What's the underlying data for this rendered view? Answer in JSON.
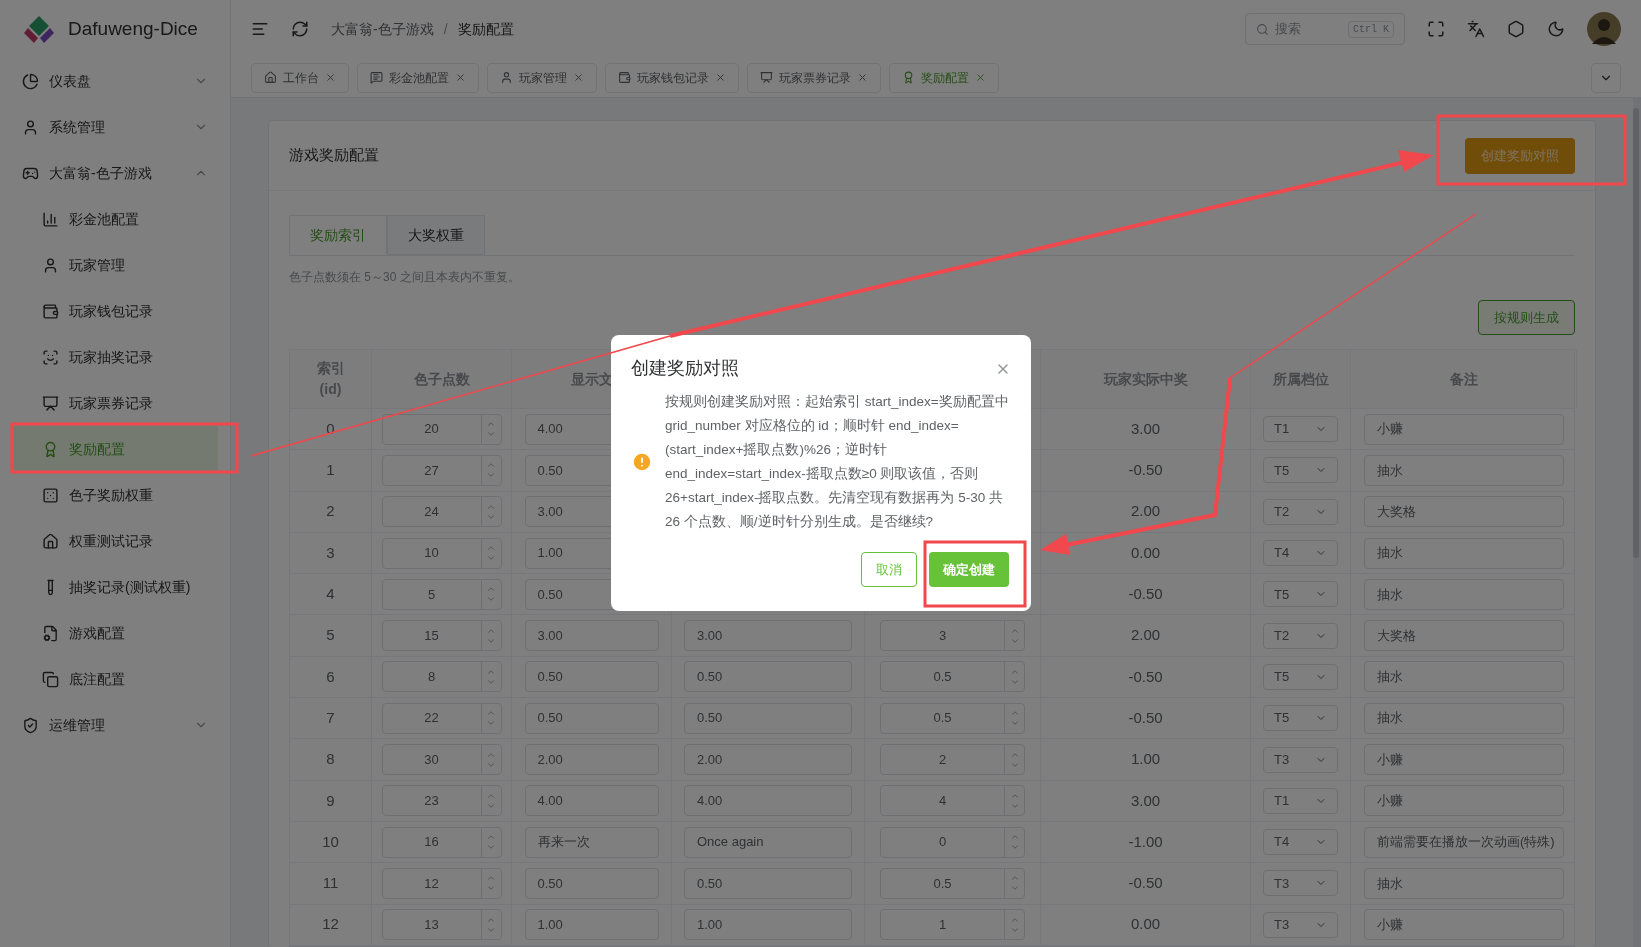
{
  "app": {
    "title": "Dafuweng-Dice"
  },
  "header": {
    "breadcrumb": [
      "大富翁-色子游戏",
      "奖励配置"
    ],
    "separator": "/",
    "search": {
      "placeholder": "搜索",
      "shortcut": "Ctrl K"
    }
  },
  "page_tabs": [
    {
      "label": "工作台",
      "selected": false
    },
    {
      "label": "彩金池配置",
      "selected": false
    },
    {
      "label": "玩家管理",
      "selected": false
    },
    {
      "label": "玩家钱包记录",
      "selected": false
    },
    {
      "label": "玩家票券记录",
      "selected": false
    },
    {
      "label": "奖励配置",
      "selected": true
    }
  ],
  "sidebar": {
    "items": [
      {
        "label": "仪表盘",
        "expanded": false
      },
      {
        "label": "系统管理",
        "expanded": false
      },
      {
        "label": "大富翁-色子游戏",
        "expanded": true,
        "children": [
          {
            "label": "彩金池配置",
            "selected": false
          },
          {
            "label": "玩家管理",
            "selected": false
          },
          {
            "label": "玩家钱包记录",
            "selected": false
          },
          {
            "label": "玩家抽奖记录",
            "selected": false
          },
          {
            "label": "玩家票券记录",
            "selected": false
          },
          {
            "label": "奖励配置",
            "selected": true
          },
          {
            "label": "色子奖励权重",
            "selected": false
          },
          {
            "label": "权重测试记录",
            "selected": false
          },
          {
            "label": "抽奖记录(测试权重)",
            "selected": false
          },
          {
            "label": "游戏配置",
            "selected": false
          },
          {
            "label": "底注配置",
            "selected": false
          }
        ]
      },
      {
        "label": "运维管理",
        "expanded": false
      }
    ]
  },
  "card": {
    "title": "游戏奖励配置",
    "create_button": "创建奖励对照",
    "tabs": [
      {
        "label": "奖励索引",
        "selected": true
      },
      {
        "label": "大奖权重",
        "selected": false
      }
    ],
    "hint": "色子点数须在 5～30 之间且本表内不重复。",
    "generate_button": "按规则生成",
    "table": {
      "columns": [
        {
          "label": "索引 (id)"
        },
        {
          "label": "色子点数"
        },
        {
          "label": "显示文"
        },
        {},
        {},
        {
          "label": "玩家实际中奖"
        },
        {
          "label": "所属档位"
        },
        {
          "label": "备注"
        }
      ],
      "rows": [
        {
          "index": "0",
          "dice": "20",
          "display": "4.00",
          "actual": "3.00",
          "tier": "T1",
          "remark": "小赚"
        },
        {
          "index": "1",
          "dice": "27",
          "display": "0.50",
          "actual": "-0.50",
          "tier": "T5",
          "remark": "抽水"
        },
        {
          "index": "2",
          "dice": "24",
          "display": "3.00",
          "actual": "2.00",
          "tier": "T2",
          "remark": "大奖格"
        },
        {
          "index": "3",
          "dice": "10",
          "display": "1.00",
          "actual": "0.00",
          "tier": "T4",
          "remark": "抽水"
        },
        {
          "index": "4",
          "dice": "5",
          "display": "0.50",
          "actual": "-0.50",
          "tier": "T5",
          "remark": "抽水"
        },
        {
          "index": "5",
          "dice": "15",
          "display": "3.00",
          "display_en": "3.00",
          "multiplier": "3",
          "actual": "2.00",
          "tier": "T2",
          "remark": "大奖格"
        },
        {
          "index": "6",
          "dice": "8",
          "display": "0.50",
          "display_en": "0.50",
          "multiplier": "0.5",
          "actual": "-0.50",
          "tier": "T5",
          "remark": "抽水"
        },
        {
          "index": "7",
          "dice": "22",
          "display": "0.50",
          "display_en": "0.50",
          "multiplier": "0.5",
          "actual": "-0.50",
          "tier": "T5",
          "remark": "抽水"
        },
        {
          "index": "8",
          "dice": "30",
          "display": "2.00",
          "display_en": "2.00",
          "multiplier": "2",
          "actual": "1.00",
          "tier": "T3",
          "remark": "小赚"
        },
        {
          "index": "9",
          "dice": "23",
          "display": "4.00",
          "display_en": "4.00",
          "multiplier": "4",
          "actual": "3.00",
          "tier": "T1",
          "remark": "小赚"
        },
        {
          "index": "10",
          "dice": "16",
          "display": "再来一次",
          "display_en": "Once again",
          "multiplier": "0",
          "actual": "-1.00",
          "tier": "T4",
          "remark": "前端需要在播放一次动画(特殊)"
        },
        {
          "index": "11",
          "dice": "12",
          "display": "0.50",
          "display_en": "0.50",
          "multiplier": "0.5",
          "actual": "-0.50",
          "tier": "T3",
          "remark": "抽水"
        },
        {
          "index": "12",
          "dice": "13",
          "display": "1.00",
          "display_en": "1.00",
          "multiplier": "1",
          "actual": "0.00",
          "tier": "T3",
          "remark": "小赚"
        }
      ]
    }
  },
  "dialog": {
    "title": "创建奖励对照",
    "message": "按规则创建奖励对照：起始索引 start_index=奖励配置中 grid_number 对应格位的 id；顺时针 end_index=(start_index+摇取点数)%26；逆时针 end_index=start_index-摇取点数≥0 则取该值，否则 26+start_index-摇取点数。先清空现有数据再为 5-30 共 26 个点数、顺/逆时针分别生成。是否继续?",
    "cancel": "取消",
    "confirm": "确定创建"
  }
}
